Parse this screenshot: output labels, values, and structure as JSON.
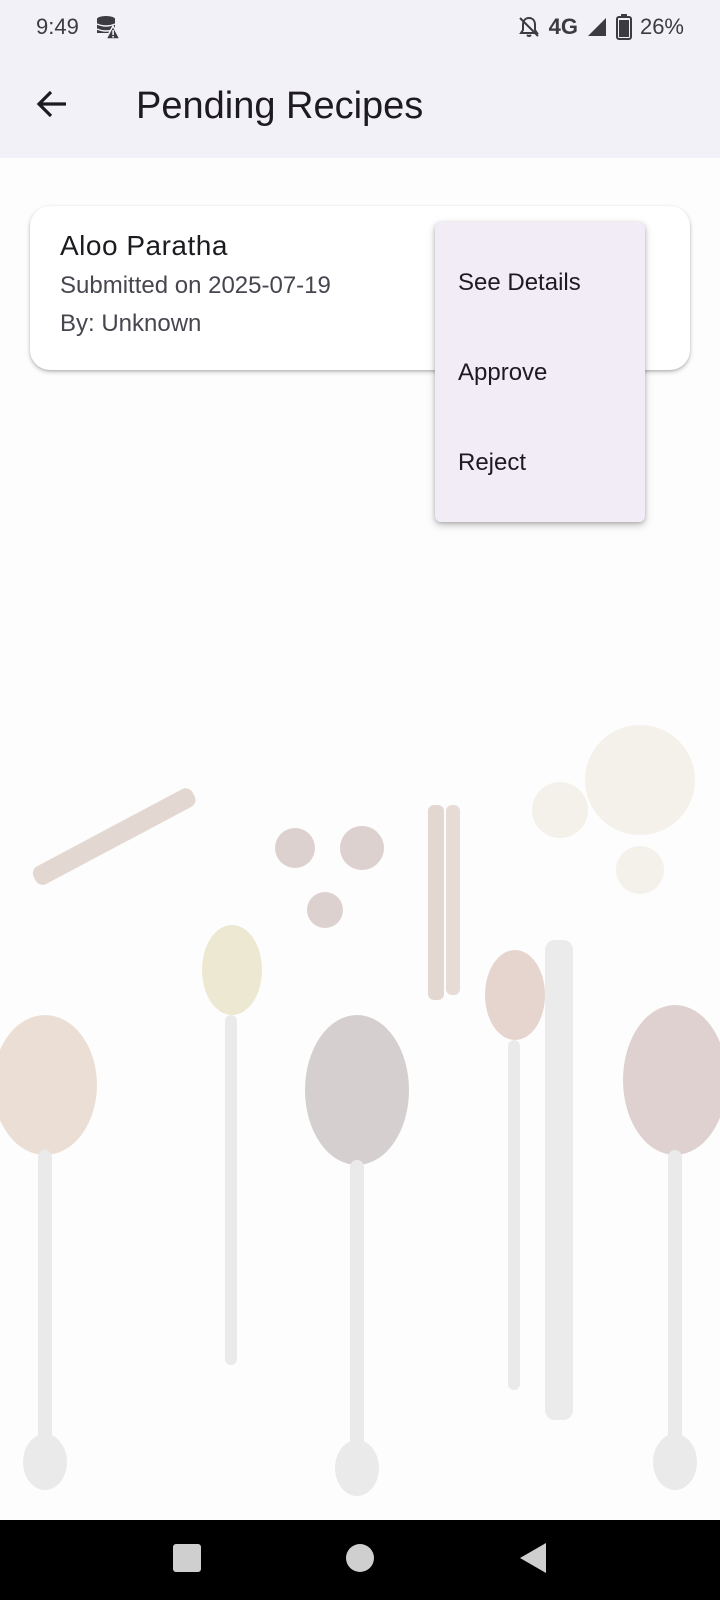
{
  "status_bar": {
    "time": "9:49",
    "network": "4G",
    "battery": "26%",
    "icons": [
      "storage-warning-icon",
      "bell-off-icon",
      "signal-icon",
      "battery-icon"
    ]
  },
  "app_bar": {
    "title": "Pending Recipes",
    "back_icon": "arrow-back-icon"
  },
  "recipes": [
    {
      "name": "Aloo Paratha",
      "submitted": "Submitted on 2025-07-19",
      "author": "By: Unknown"
    }
  ],
  "menu": {
    "items": [
      {
        "label": "See Details"
      },
      {
        "label": "Approve"
      },
      {
        "label": "Reject"
      }
    ]
  },
  "nav_bar": {
    "icons": [
      "recents-square-icon",
      "home-circle-icon",
      "back-triangle-icon"
    ]
  },
  "colors": {
    "app_bar_bg": "#f3f1f8",
    "menu_bg": "#f1ecf6",
    "card_bg": "#ffffff"
  }
}
